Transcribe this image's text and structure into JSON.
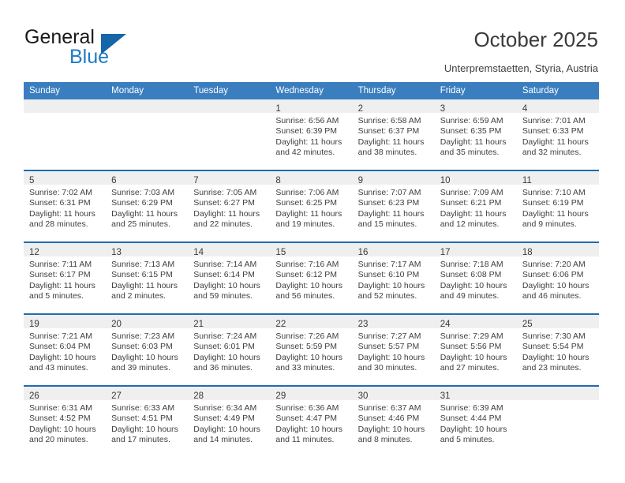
{
  "brand": {
    "word_one": "General",
    "word_two": "Blue",
    "triangle_icon": "blue-triangle-logo-mark",
    "color_dark": "#1a1a1a",
    "color_blue": "#1d7bc4",
    "color_triangle": "#1565a8"
  },
  "header": {
    "title": "October 2025",
    "subtitle": "Unterpremstaetten, Styria, Austria"
  },
  "theme": {
    "header_blue": "#3a7ebf",
    "row_divider_blue": "#1f6cb0",
    "daynum_band": "#efefef",
    "text": "#3f3f3f"
  },
  "weekday_headers": [
    "Sunday",
    "Monday",
    "Tuesday",
    "Wednesday",
    "Thursday",
    "Friday",
    "Saturday"
  ],
  "labels": {
    "sunrise_prefix": "Sunrise:",
    "sunset_prefix": "Sunset:",
    "daylight_prefix": "Daylight:"
  },
  "weeks": [
    [
      {
        "day": "",
        "empty": true
      },
      {
        "day": "",
        "empty": true
      },
      {
        "day": "",
        "empty": true
      },
      {
        "day": "1",
        "sunrise": "Sunrise: 6:56 AM",
        "sunset": "Sunset: 6:39 PM",
        "daylight_a": "Daylight: 11 hours",
        "daylight_b": "and 42 minutes."
      },
      {
        "day": "2",
        "sunrise": "Sunrise: 6:58 AM",
        "sunset": "Sunset: 6:37 PM",
        "daylight_a": "Daylight: 11 hours",
        "daylight_b": "and 38 minutes."
      },
      {
        "day": "3",
        "sunrise": "Sunrise: 6:59 AM",
        "sunset": "Sunset: 6:35 PM",
        "daylight_a": "Daylight: 11 hours",
        "daylight_b": "and 35 minutes."
      },
      {
        "day": "4",
        "sunrise": "Sunrise: 7:01 AM",
        "sunset": "Sunset: 6:33 PM",
        "daylight_a": "Daylight: 11 hours",
        "daylight_b": "and 32 minutes."
      }
    ],
    [
      {
        "day": "5",
        "sunrise": "Sunrise: 7:02 AM",
        "sunset": "Sunset: 6:31 PM",
        "daylight_a": "Daylight: 11 hours",
        "daylight_b": "and 28 minutes."
      },
      {
        "day": "6",
        "sunrise": "Sunrise: 7:03 AM",
        "sunset": "Sunset: 6:29 PM",
        "daylight_a": "Daylight: 11 hours",
        "daylight_b": "and 25 minutes."
      },
      {
        "day": "7",
        "sunrise": "Sunrise: 7:05 AM",
        "sunset": "Sunset: 6:27 PM",
        "daylight_a": "Daylight: 11 hours",
        "daylight_b": "and 22 minutes."
      },
      {
        "day": "8",
        "sunrise": "Sunrise: 7:06 AM",
        "sunset": "Sunset: 6:25 PM",
        "daylight_a": "Daylight: 11 hours",
        "daylight_b": "and 19 minutes."
      },
      {
        "day": "9",
        "sunrise": "Sunrise: 7:07 AM",
        "sunset": "Sunset: 6:23 PM",
        "daylight_a": "Daylight: 11 hours",
        "daylight_b": "and 15 minutes."
      },
      {
        "day": "10",
        "sunrise": "Sunrise: 7:09 AM",
        "sunset": "Sunset: 6:21 PM",
        "daylight_a": "Daylight: 11 hours",
        "daylight_b": "and 12 minutes."
      },
      {
        "day": "11",
        "sunrise": "Sunrise: 7:10 AM",
        "sunset": "Sunset: 6:19 PM",
        "daylight_a": "Daylight: 11 hours",
        "daylight_b": "and 9 minutes."
      }
    ],
    [
      {
        "day": "12",
        "sunrise": "Sunrise: 7:11 AM",
        "sunset": "Sunset: 6:17 PM",
        "daylight_a": "Daylight: 11 hours",
        "daylight_b": "and 5 minutes."
      },
      {
        "day": "13",
        "sunrise": "Sunrise: 7:13 AM",
        "sunset": "Sunset: 6:15 PM",
        "daylight_a": "Daylight: 11 hours",
        "daylight_b": "and 2 minutes."
      },
      {
        "day": "14",
        "sunrise": "Sunrise: 7:14 AM",
        "sunset": "Sunset: 6:14 PM",
        "daylight_a": "Daylight: 10 hours",
        "daylight_b": "and 59 minutes."
      },
      {
        "day": "15",
        "sunrise": "Sunrise: 7:16 AM",
        "sunset": "Sunset: 6:12 PM",
        "daylight_a": "Daylight: 10 hours",
        "daylight_b": "and 56 minutes."
      },
      {
        "day": "16",
        "sunrise": "Sunrise: 7:17 AM",
        "sunset": "Sunset: 6:10 PM",
        "daylight_a": "Daylight: 10 hours",
        "daylight_b": "and 52 minutes."
      },
      {
        "day": "17",
        "sunrise": "Sunrise: 7:18 AM",
        "sunset": "Sunset: 6:08 PM",
        "daylight_a": "Daylight: 10 hours",
        "daylight_b": "and 49 minutes."
      },
      {
        "day": "18",
        "sunrise": "Sunrise: 7:20 AM",
        "sunset": "Sunset: 6:06 PM",
        "daylight_a": "Daylight: 10 hours",
        "daylight_b": "and 46 minutes."
      }
    ],
    [
      {
        "day": "19",
        "sunrise": "Sunrise: 7:21 AM",
        "sunset": "Sunset: 6:04 PM",
        "daylight_a": "Daylight: 10 hours",
        "daylight_b": "and 43 minutes."
      },
      {
        "day": "20",
        "sunrise": "Sunrise: 7:23 AM",
        "sunset": "Sunset: 6:03 PM",
        "daylight_a": "Daylight: 10 hours",
        "daylight_b": "and 39 minutes."
      },
      {
        "day": "21",
        "sunrise": "Sunrise: 7:24 AM",
        "sunset": "Sunset: 6:01 PM",
        "daylight_a": "Daylight: 10 hours",
        "daylight_b": "and 36 minutes."
      },
      {
        "day": "22",
        "sunrise": "Sunrise: 7:26 AM",
        "sunset": "Sunset: 5:59 PM",
        "daylight_a": "Daylight: 10 hours",
        "daylight_b": "and 33 minutes."
      },
      {
        "day": "23",
        "sunrise": "Sunrise: 7:27 AM",
        "sunset": "Sunset: 5:57 PM",
        "daylight_a": "Daylight: 10 hours",
        "daylight_b": "and 30 minutes."
      },
      {
        "day": "24",
        "sunrise": "Sunrise: 7:29 AM",
        "sunset": "Sunset: 5:56 PM",
        "daylight_a": "Daylight: 10 hours",
        "daylight_b": "and 27 minutes."
      },
      {
        "day": "25",
        "sunrise": "Sunrise: 7:30 AM",
        "sunset": "Sunset: 5:54 PM",
        "daylight_a": "Daylight: 10 hours",
        "daylight_b": "and 23 minutes."
      }
    ],
    [
      {
        "day": "26",
        "sunrise": "Sunrise: 6:31 AM",
        "sunset": "Sunset: 4:52 PM",
        "daylight_a": "Daylight: 10 hours",
        "daylight_b": "and 20 minutes."
      },
      {
        "day": "27",
        "sunrise": "Sunrise: 6:33 AM",
        "sunset": "Sunset: 4:51 PM",
        "daylight_a": "Daylight: 10 hours",
        "daylight_b": "and 17 minutes."
      },
      {
        "day": "28",
        "sunrise": "Sunrise: 6:34 AM",
        "sunset": "Sunset: 4:49 PM",
        "daylight_a": "Daylight: 10 hours",
        "daylight_b": "and 14 minutes."
      },
      {
        "day": "29",
        "sunrise": "Sunrise: 6:36 AM",
        "sunset": "Sunset: 4:47 PM",
        "daylight_a": "Daylight: 10 hours",
        "daylight_b": "and 11 minutes."
      },
      {
        "day": "30",
        "sunrise": "Sunrise: 6:37 AM",
        "sunset": "Sunset: 4:46 PM",
        "daylight_a": "Daylight: 10 hours",
        "daylight_b": "and 8 minutes."
      },
      {
        "day": "31",
        "sunrise": "Sunrise: 6:39 AM",
        "sunset": "Sunset: 4:44 PM",
        "daylight_a": "Daylight: 10 hours",
        "daylight_b": "and 5 minutes."
      },
      {
        "day": "",
        "empty": true
      }
    ]
  ]
}
